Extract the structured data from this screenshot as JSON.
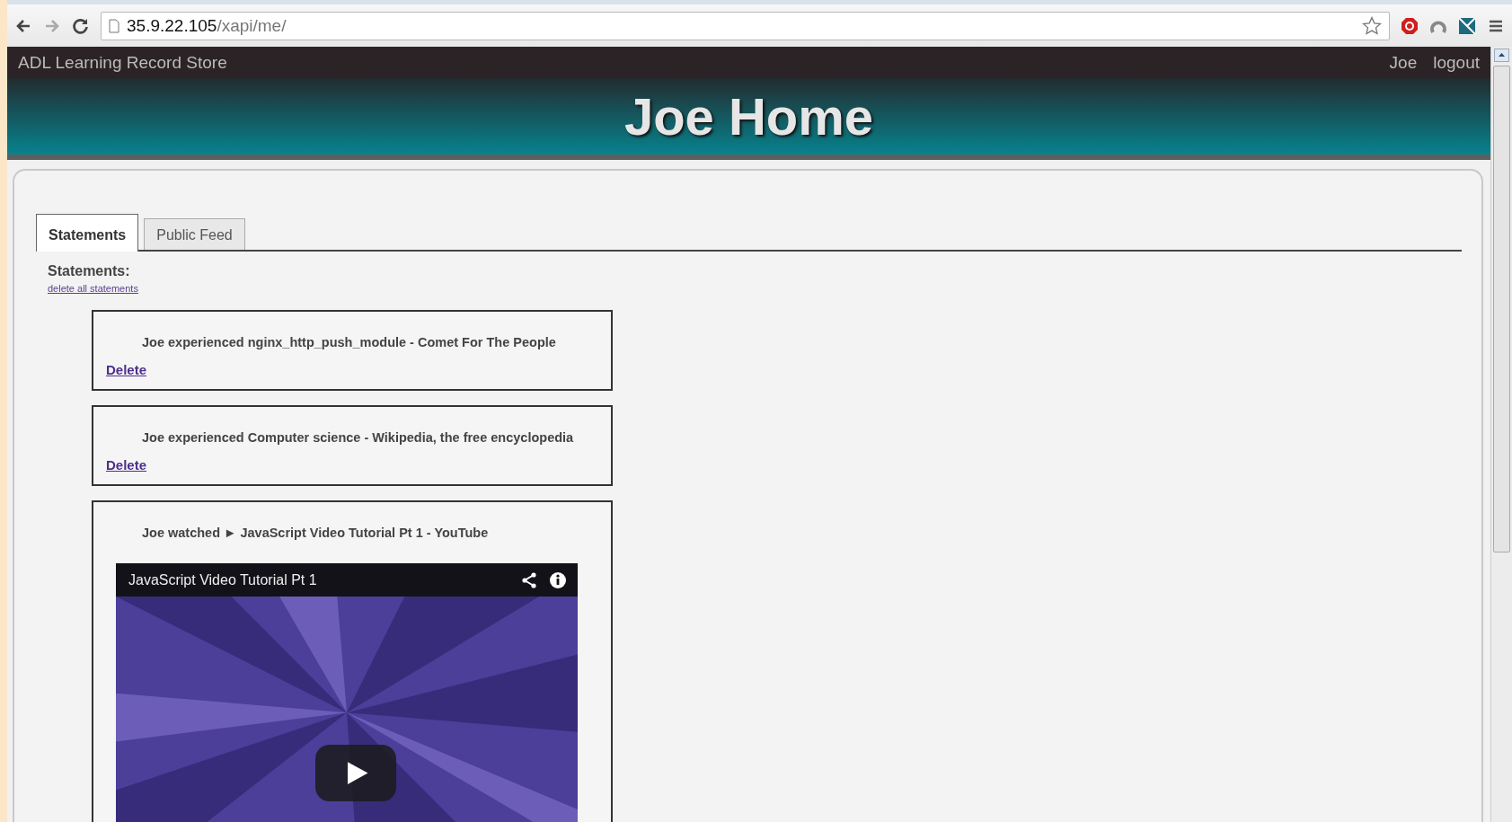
{
  "browser": {
    "url_host": "35.9.22.105",
    "url_path": "/xapi/me/"
  },
  "navbar": {
    "brand": "ADL Learning Record Store",
    "links": [
      "Joe",
      "logout"
    ]
  },
  "header": {
    "title": "Joe Home"
  },
  "tabs": [
    {
      "label": "Statements",
      "selected": true
    },
    {
      "label": "Public Feed",
      "selected": false
    }
  ],
  "statements": {
    "heading": "Statements:",
    "delete_all": "delete all statements",
    "items": [
      {
        "kind": "text",
        "text": "Joe experienced nginx_http_push_module - Comet For The People",
        "action": "Delete"
      },
      {
        "kind": "text",
        "text": "Joe experienced Computer science - Wikipedia, the free encyclopedia",
        "action": "Delete"
      },
      {
        "kind": "video",
        "text": "Joe watched ► JavaScript Video Tutorial Pt 1 - YouTube",
        "video_title": "JavaScript Video Tutorial Pt 1"
      }
    ]
  }
}
